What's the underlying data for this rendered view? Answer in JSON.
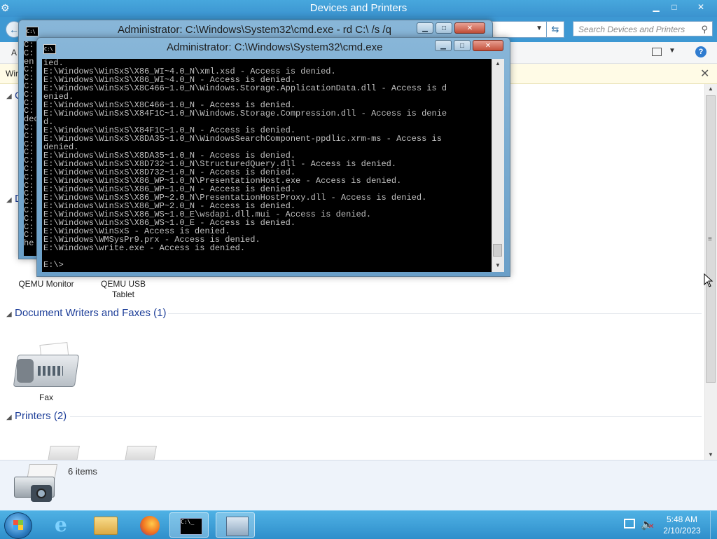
{
  "explorer": {
    "title": "Devices and Printers",
    "search_placeholder": "Search Devices and Printers",
    "toolbar_partial_label": "A",
    "infobar_partial_text": "Win",
    "sections": {
      "devices_partial_letter": "D",
      "other_partial_letter": "C",
      "document_writers": "Document Writers and Faxes (1)",
      "printers": "Printers (2)"
    },
    "devices": [
      {
        "label": "QEMU Monitor"
      },
      {
        "label": "QEMU USB Tablet"
      }
    ],
    "fax": {
      "label": "Fax"
    },
    "details": {
      "count": "6 items"
    }
  },
  "cmd_back": {
    "title": "Administrator: C:\\Windows\\System32\\cmd.exe - rd  C:\\ /s /q",
    "console_text": "C:\nC:\nen\nC:\nC:\nC:\nC:\nC:\nC:\nded\nC:\nC:\nC:\nC:\nC:\nC:\nC:\nC:\nC:\nC:\nC:\nC:\nC:\nC:\nhe"
  },
  "cmd_front": {
    "title": "Administrator: C:\\Windows\\System32\\cmd.exe",
    "console_text": "ied.\nE:\\Windows\\WinSxS\\X86_WI~4.0_N\\xml.xsd - Access is denied.\nE:\\Windows\\WinSxS\\X86_WI~4.0_N - Access is denied.\nE:\\Windows\\WinSxS\\X8C466~1.0_N\\Windows.Storage.ApplicationData.dll - Access is d\nenied.\nE:\\Windows\\WinSxS\\X8C466~1.0_N - Access is denied.\nE:\\Windows\\WinSxS\\X84F1C~1.0_N\\Windows.Storage.Compression.dll - Access is denie\nd.\nE:\\Windows\\WinSxS\\X84F1C~1.0_N - Access is denied.\nE:\\Windows\\WinSxS\\X8DA35~1.0_N\\WindowsSearchComponent-ppdlic.xrm-ms - Access is\ndenied.\nE:\\Windows\\WinSxS\\X8DA35~1.0_N - Access is denied.\nE:\\Windows\\WinSxS\\X8D732~1.0_N\\StructuredQuery.dll - Access is denied.\nE:\\Windows\\WinSxS\\X8D732~1.0_N - Access is denied.\nE:\\Windows\\WinSxS\\X86_WP~1.0_N\\PresentationHost.exe - Access is denied.\nE:\\Windows\\WinSxS\\X86_WP~1.0_N - Access is denied.\nE:\\Windows\\WinSxS\\X86_WP~2.0_N\\PresentationHostProxy.dll - Access is denied.\nE:\\Windows\\WinSxS\\X86_WP~2.0_N - Access is denied.\nE:\\Windows\\WinSxS\\X86_WS~1.0_E\\wsdapi.dll.mui - Access is denied.\nE:\\Windows\\WinSxS\\X86_WS~1.0_E - Access is denied.\nE:\\Windows\\WinSxS - Access is denied.\nE:\\Windows\\WMSysPr9.prx - Access is denied.\nE:\\Windows\\write.exe - Access is denied.\n\nE:\\>"
  },
  "window_buttons": {
    "minimize": "▁",
    "maximize": "□",
    "close": "✕"
  },
  "taskbar": {
    "time": "5:48 AM",
    "date": "2/10/2023"
  },
  "icons": {
    "app": "devices-printers-icon",
    "back": "back-arrow-icon",
    "refresh": "refresh-icon",
    "search": "search-icon",
    "help": "help-icon",
    "start": "windows-start-icon",
    "ie": "internet-explorer-icon",
    "explorer": "file-explorer-icon",
    "firefox": "firefox-icon",
    "cmd": "command-prompt-icon",
    "devices": "devices-and-printers-icon",
    "network": "network-icon",
    "volume": "volume-muted-icon"
  },
  "colors": {
    "titlebar": "#3b93cf",
    "section_heading": "#1e3f99",
    "console_bg": "#000000",
    "console_fg": "#c0c0c0",
    "taskbar": "#2f8fcb"
  }
}
